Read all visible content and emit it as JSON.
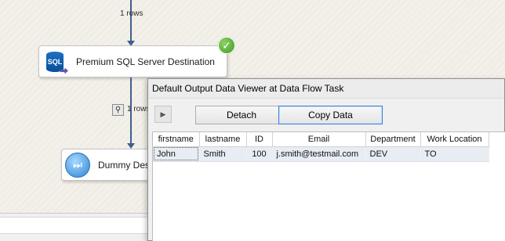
{
  "designer": {
    "upper_connector_label": "1 rows",
    "lower_connector_label": "1 rows",
    "sql_destination": {
      "icon_text": "SQL",
      "label": "Premium SQL Server Destination",
      "status": "success"
    },
    "dummy_destination": {
      "label": "Dummy Destination"
    }
  },
  "viewer": {
    "title": "Default Output Data Viewer at Data Flow Task",
    "buttons": {
      "detach": "Detach",
      "copy_data": "Copy Data"
    },
    "columns": [
      "firstname",
      "lastname",
      "ID",
      "Email",
      "Department",
      "Work Location"
    ],
    "rows": [
      [
        "John",
        "Smith",
        "100",
        "j.smith@testmail.com",
        "DEV",
        "TO"
      ]
    ]
  },
  "colors": {
    "connector": "#3f5f8f",
    "success": "#4caf2a",
    "focus": "#3a7bd5",
    "selected_row": "#e8ecf3"
  },
  "icons": [
    "sql-database-icon",
    "success-check-icon",
    "data-viewer-icon",
    "dummy-destination-icon",
    "play-icon"
  ]
}
